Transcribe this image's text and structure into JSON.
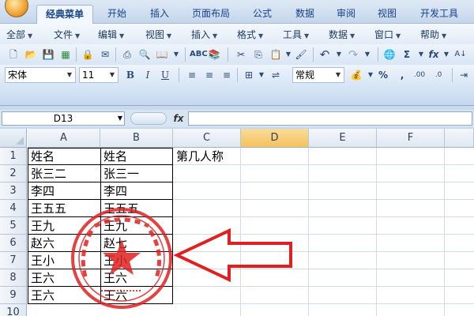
{
  "ribbon_tabs": [
    "经典菜单",
    "开始",
    "插入",
    "页面布局",
    "公式",
    "数据",
    "审阅",
    "视图",
    "开发工具"
  ],
  "active_tab": "经典菜单",
  "menus": [
    "全部",
    "文件",
    "编辑",
    "视图",
    "插入",
    "格式",
    "工具",
    "数据",
    "窗口",
    "帮助"
  ],
  "toolbar": {
    "font_name": "宋体",
    "font_size": "11",
    "number_format": "常规",
    "bold": "B",
    "italic": "I",
    "underline": "U",
    "percent": "%",
    "comma": ",",
    "sum": "Σ",
    "fx": "fx"
  },
  "formula_bar": {
    "name_box": "D13",
    "fx_label": "fx",
    "formula": ""
  },
  "sheet": {
    "columns": [
      "A",
      "B",
      "C",
      "D",
      "E",
      "F"
    ],
    "selected_column": "D",
    "rows": [
      "1",
      "2",
      "3",
      "4",
      "5",
      "6",
      "7",
      "8",
      "9",
      "10"
    ],
    "cells": {
      "A": [
        "姓名",
        "张三二",
        "李四",
        "王五五",
        "王九",
        "赵六",
        "王小",
        "王六",
        "王六"
      ],
      "B": [
        "姓名",
        "张三一",
        "李四",
        "王五五",
        "王九",
        "赵七",
        "王小",
        "王六",
        "王六"
      ],
      "C1": "第几人称"
    }
  },
  "colors": {
    "stamp": "#e02020",
    "arrow": "#e02020",
    "accent": "#15428b"
  }
}
